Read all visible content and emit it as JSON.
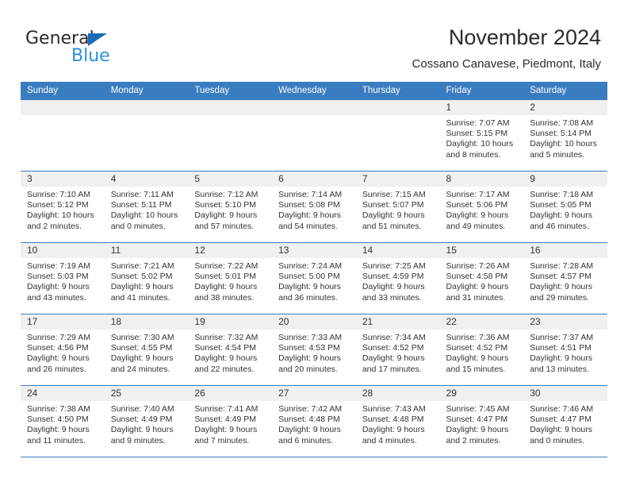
{
  "brand": {
    "name_primary": "General",
    "name_secondary": "Blue",
    "accent_color": "#2b8fdd",
    "logo_triangle_color": "#1a6bb5"
  },
  "header": {
    "title": "November 2024",
    "subtitle": "Cossano Canavese, Piedmont, Italy"
  },
  "calendar": {
    "header_bg": "#3a7cc0",
    "daynum_band_bg": "#f0f0f0",
    "weekday_headers": [
      "Sunday",
      "Monday",
      "Tuesday",
      "Wednesday",
      "Thursday",
      "Friday",
      "Saturday"
    ],
    "weeks": [
      [
        {
          "day": "",
          "lines": []
        },
        {
          "day": "",
          "lines": []
        },
        {
          "day": "",
          "lines": []
        },
        {
          "day": "",
          "lines": []
        },
        {
          "day": "",
          "lines": []
        },
        {
          "day": "1",
          "lines": [
            "Sunrise: 7:07 AM",
            "Sunset: 5:15 PM",
            "Daylight: 10 hours",
            "and 8 minutes."
          ]
        },
        {
          "day": "2",
          "lines": [
            "Sunrise: 7:08 AM",
            "Sunset: 5:14 PM",
            "Daylight: 10 hours",
            "and 5 minutes."
          ]
        }
      ],
      [
        {
          "day": "3",
          "lines": [
            "Sunrise: 7:10 AM",
            "Sunset: 5:12 PM",
            "Daylight: 10 hours",
            "and 2 minutes."
          ]
        },
        {
          "day": "4",
          "lines": [
            "Sunrise: 7:11 AM",
            "Sunset: 5:11 PM",
            "Daylight: 10 hours",
            "and 0 minutes."
          ]
        },
        {
          "day": "5",
          "lines": [
            "Sunrise: 7:12 AM",
            "Sunset: 5:10 PM",
            "Daylight: 9 hours",
            "and 57 minutes."
          ]
        },
        {
          "day": "6",
          "lines": [
            "Sunrise: 7:14 AM",
            "Sunset: 5:08 PM",
            "Daylight: 9 hours",
            "and 54 minutes."
          ]
        },
        {
          "day": "7",
          "lines": [
            "Sunrise: 7:15 AM",
            "Sunset: 5:07 PM",
            "Daylight: 9 hours",
            "and 51 minutes."
          ]
        },
        {
          "day": "8",
          "lines": [
            "Sunrise: 7:17 AM",
            "Sunset: 5:06 PM",
            "Daylight: 9 hours",
            "and 49 minutes."
          ]
        },
        {
          "day": "9",
          "lines": [
            "Sunrise: 7:18 AM",
            "Sunset: 5:05 PM",
            "Daylight: 9 hours",
            "and 46 minutes."
          ]
        }
      ],
      [
        {
          "day": "10",
          "lines": [
            "Sunrise: 7:19 AM",
            "Sunset: 5:03 PM",
            "Daylight: 9 hours",
            "and 43 minutes."
          ]
        },
        {
          "day": "11",
          "lines": [
            "Sunrise: 7:21 AM",
            "Sunset: 5:02 PM",
            "Daylight: 9 hours",
            "and 41 minutes."
          ]
        },
        {
          "day": "12",
          "lines": [
            "Sunrise: 7:22 AM",
            "Sunset: 5:01 PM",
            "Daylight: 9 hours",
            "and 38 minutes."
          ]
        },
        {
          "day": "13",
          "lines": [
            "Sunrise: 7:24 AM",
            "Sunset: 5:00 PM",
            "Daylight: 9 hours",
            "and 36 minutes."
          ]
        },
        {
          "day": "14",
          "lines": [
            "Sunrise: 7:25 AM",
            "Sunset: 4:59 PM",
            "Daylight: 9 hours",
            "and 33 minutes."
          ]
        },
        {
          "day": "15",
          "lines": [
            "Sunrise: 7:26 AM",
            "Sunset: 4:58 PM",
            "Daylight: 9 hours",
            "and 31 minutes."
          ]
        },
        {
          "day": "16",
          "lines": [
            "Sunrise: 7:28 AM",
            "Sunset: 4:57 PM",
            "Daylight: 9 hours",
            "and 29 minutes."
          ]
        }
      ],
      [
        {
          "day": "17",
          "lines": [
            "Sunrise: 7:29 AM",
            "Sunset: 4:56 PM",
            "Daylight: 9 hours",
            "and 26 minutes."
          ]
        },
        {
          "day": "18",
          "lines": [
            "Sunrise: 7:30 AM",
            "Sunset: 4:55 PM",
            "Daylight: 9 hours",
            "and 24 minutes."
          ]
        },
        {
          "day": "19",
          "lines": [
            "Sunrise: 7:32 AM",
            "Sunset: 4:54 PM",
            "Daylight: 9 hours",
            "and 22 minutes."
          ]
        },
        {
          "day": "20",
          "lines": [
            "Sunrise: 7:33 AM",
            "Sunset: 4:53 PM",
            "Daylight: 9 hours",
            "and 20 minutes."
          ]
        },
        {
          "day": "21",
          "lines": [
            "Sunrise: 7:34 AM",
            "Sunset: 4:52 PM",
            "Daylight: 9 hours",
            "and 17 minutes."
          ]
        },
        {
          "day": "22",
          "lines": [
            "Sunrise: 7:36 AM",
            "Sunset: 4:52 PM",
            "Daylight: 9 hours",
            "and 15 minutes."
          ]
        },
        {
          "day": "23",
          "lines": [
            "Sunrise: 7:37 AM",
            "Sunset: 4:51 PM",
            "Daylight: 9 hours",
            "and 13 minutes."
          ]
        }
      ],
      [
        {
          "day": "24",
          "lines": [
            "Sunrise: 7:38 AM",
            "Sunset: 4:50 PM",
            "Daylight: 9 hours",
            "and 11 minutes."
          ]
        },
        {
          "day": "25",
          "lines": [
            "Sunrise: 7:40 AM",
            "Sunset: 4:49 PM",
            "Daylight: 9 hours",
            "and 9 minutes."
          ]
        },
        {
          "day": "26",
          "lines": [
            "Sunrise: 7:41 AM",
            "Sunset: 4:49 PM",
            "Daylight: 9 hours",
            "and 7 minutes."
          ]
        },
        {
          "day": "27",
          "lines": [
            "Sunrise: 7:42 AM",
            "Sunset: 4:48 PM",
            "Daylight: 9 hours",
            "and 6 minutes."
          ]
        },
        {
          "day": "28",
          "lines": [
            "Sunrise: 7:43 AM",
            "Sunset: 4:48 PM",
            "Daylight: 9 hours",
            "and 4 minutes."
          ]
        },
        {
          "day": "29",
          "lines": [
            "Sunrise: 7:45 AM",
            "Sunset: 4:47 PM",
            "Daylight: 9 hours",
            "and 2 minutes."
          ]
        },
        {
          "day": "30",
          "lines": [
            "Sunrise: 7:46 AM",
            "Sunset: 4:47 PM",
            "Daylight: 9 hours",
            "and 0 minutes."
          ]
        }
      ]
    ]
  }
}
